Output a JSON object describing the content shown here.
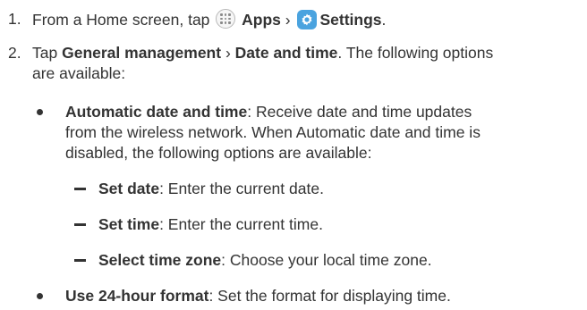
{
  "steps": [
    {
      "number": "1.",
      "prefix": "From a Home screen, tap",
      "apps_label": "Apps",
      "separator": "›",
      "settings_label": "Settings",
      "suffix": "."
    },
    {
      "number": "2.",
      "prefix": "Tap",
      "general_label": "General management",
      "separator": "›",
      "date_label": "Date and time",
      "line1_suffix": ". The following options",
      "line2": "are available:"
    }
  ],
  "options": [
    {
      "term": "Automatic date and time",
      "line1_rest": ": Receive date and time updates",
      "line2": "from the wireless network. When Automatic date and time is",
      "line3": "disabled, the following options are available:"
    },
    {
      "term": "Use 24-hour format",
      "line1_rest": ": Set the format for displaying time."
    }
  ],
  "sub_options": [
    {
      "term": "Set date",
      "rest": ": Enter the current date."
    },
    {
      "term": "Set time",
      "rest": ": Enter the current time."
    },
    {
      "term": "Select time zone",
      "rest": ": Choose your local time zone."
    }
  ],
  "icons": {
    "apps": "apps-icon",
    "settings": "gear-icon",
    "settings_bg": "#4aa3df"
  }
}
